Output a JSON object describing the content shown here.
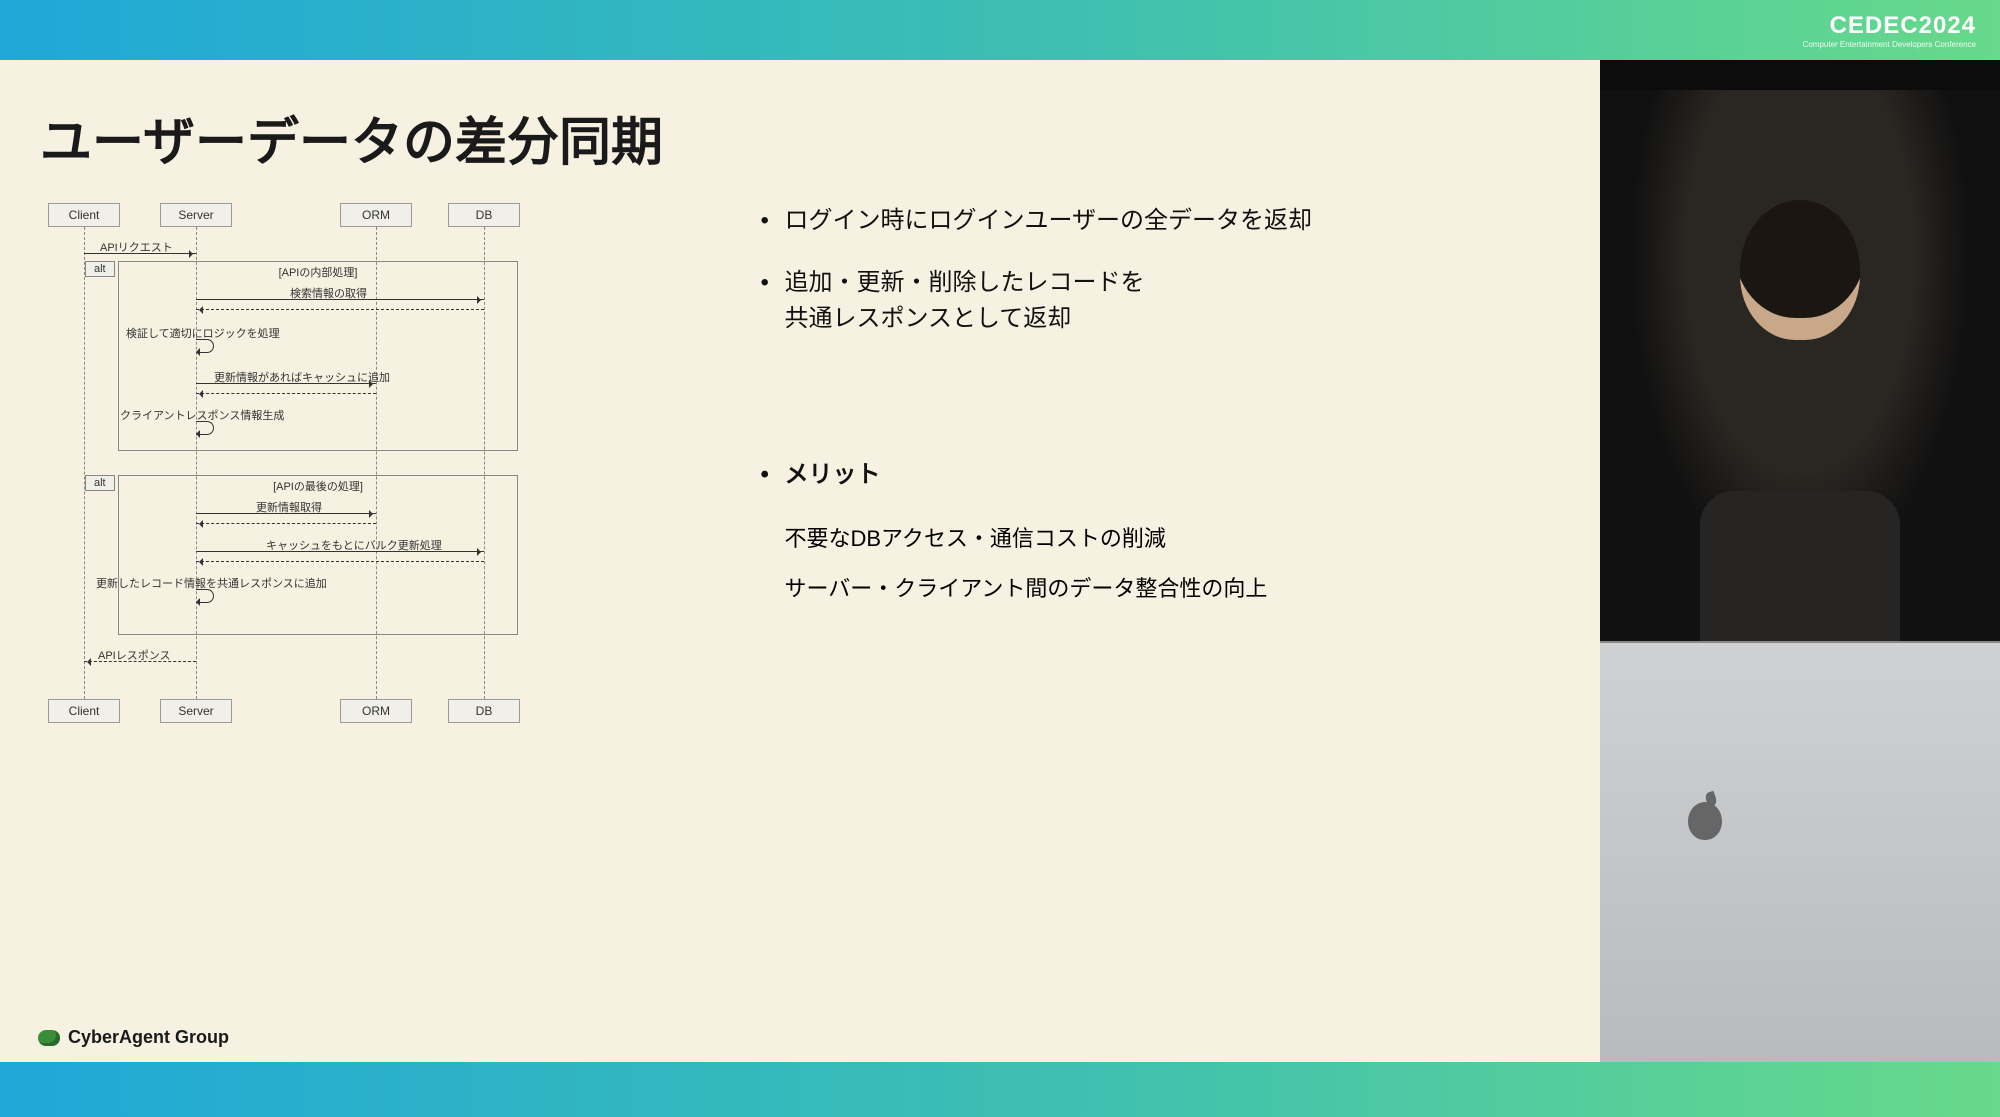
{
  "event_logo": {
    "main": "CEDEC2024",
    "sub": "Computer Entertainment Developers Conference"
  },
  "slide": {
    "title": "ユーザーデータの差分同期",
    "bullets": [
      "ログイン時にログインユーザーの全データを返却",
      "追加・更新・削除したレコードを\n共通レスポンスとして返却"
    ],
    "merit": {
      "title": "メリット",
      "lines": [
        "不要なDBアクセス・通信コストの削減",
        "サーバー・クライアント間のデータ整合性の向上"
      ]
    },
    "footer_logo": "CyberAgent Group"
  },
  "sequence": {
    "participants": [
      "Client",
      "Server",
      "ORM",
      "DB"
    ],
    "alt1": {
      "label": "alt",
      "title": "[APIの内部処理]"
    },
    "alt2": {
      "label": "alt",
      "title": "[APIの最後の処理]"
    },
    "messages": {
      "api_request": "APIリクエスト",
      "search_fetch": "検索情報の取得",
      "validate_logic": "検証して適切にロジックを処理",
      "cache_if_update": "更新情報があればキャッシュに追加",
      "gen_client_resp": "クライアントレスポンス情報生成",
      "update_fetch": "更新情報取得",
      "bulk_update": "キャッシュをもとにバルク更新処理",
      "append_common": "更新したレコード情報を共通レスポンスに追加",
      "api_response": "APIレスポンス"
    }
  },
  "colors": {
    "bg_slide": "#f6f1e1",
    "accent_green": "#3a8e3a"
  }
}
